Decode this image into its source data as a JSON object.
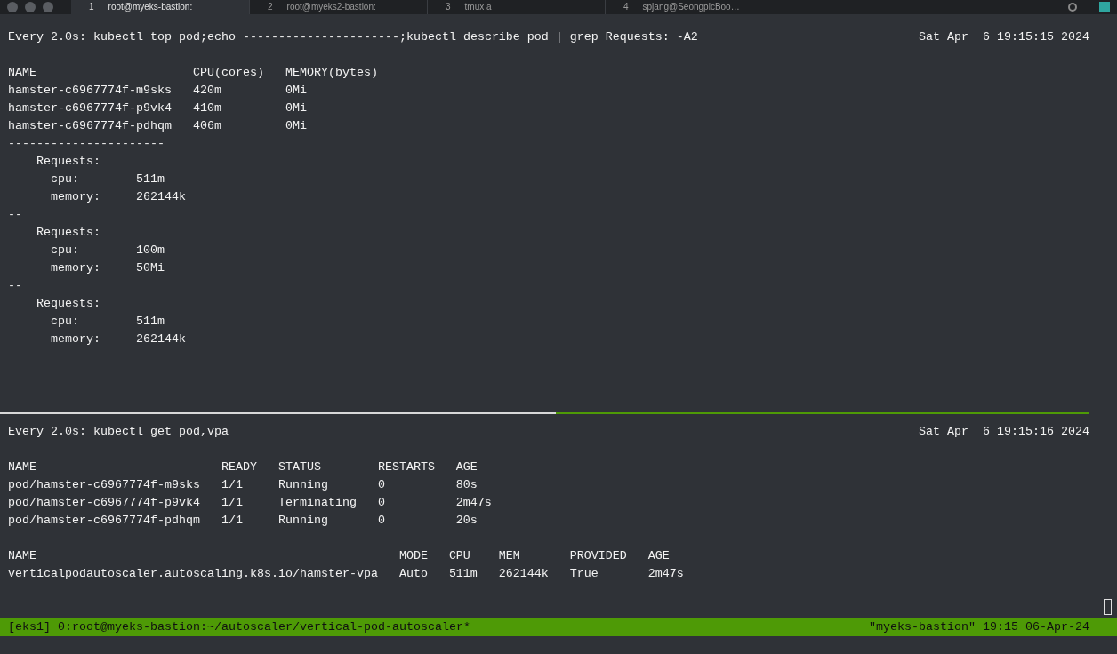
{
  "tabs": [
    {
      "number": "1",
      "title": "root@myeks-bastion:",
      "selected": true
    },
    {
      "number": "2",
      "title": "root@myeks2-bastion:",
      "selected": false
    },
    {
      "number": "3",
      "title": "tmux a",
      "selected": false
    },
    {
      "number": "4",
      "title": "spjang@SeongpicBoo…",
      "selected": false
    }
  ],
  "top_pane": {
    "command": "Every 2.0s: kubectl top pod;echo ----------------------;kubectl describe pod | grep Requests: -A2",
    "time": "Sat Apr  6 19:15:15 2024",
    "table": {
      "columns": [
        "NAME",
        "CPU(cores)",
        "MEMORY(bytes)"
      ],
      "rows": [
        [
          "hamster-c6967774f-m9sks",
          "420m",
          "0Mi"
        ],
        [
          "hamster-c6967774f-p9vk4",
          "410m",
          "0Mi"
        ],
        [
          "hamster-c6967774f-pdhqm",
          "406m",
          "0Mi"
        ]
      ]
    },
    "separator": "----------------------",
    "requests": [
      {
        "heading": "Requests:",
        "items": [
          {
            "key": "cpu:",
            "value": "511m"
          },
          {
            "key": "memory:",
            "value": "262144k"
          }
        ]
      },
      {
        "divider": "--",
        "heading": "Requests:",
        "items": [
          {
            "key": "cpu:",
            "value": "100m"
          },
          {
            "key": "memory:",
            "value": "50Mi"
          }
        ]
      },
      {
        "divider": "--",
        "heading": "Requests:",
        "items": [
          {
            "key": "cpu:",
            "value": "511m"
          },
          {
            "key": "memory:",
            "value": "262144k"
          }
        ]
      }
    ]
  },
  "bottom_pane": {
    "command": "Every 2.0s: kubectl get pod,vpa",
    "time": "Sat Apr  6 19:15:16 2024",
    "pods": {
      "columns": [
        "NAME",
        "READY",
        "STATUS",
        "RESTARTS",
        "AGE"
      ],
      "rows": [
        [
          "pod/hamster-c6967774f-m9sks",
          "1/1",
          "Running",
          "0",
          "80s"
        ],
        [
          "pod/hamster-c6967774f-p9vk4",
          "1/1",
          "Terminating",
          "0",
          "2m47s"
        ],
        [
          "pod/hamster-c6967774f-pdhqm",
          "1/1",
          "Running",
          "0",
          "20s"
        ]
      ]
    },
    "vpa": {
      "columns": [
        "NAME",
        "MODE",
        "CPU",
        "MEM",
        "PROVIDED",
        "AGE"
      ],
      "rows": [
        [
          "verticalpodautoscaler.autoscaling.k8s.io/hamster-vpa",
          "Auto",
          "511m",
          "262144k",
          "True",
          "2m47s"
        ]
      ]
    }
  },
  "status_bar": {
    "left": "[eks1] 0:root@myeks-bastion:~/autoscaler/vertical-pod-autoscaler*",
    "right": "\"myeks-bastion\" 19:15 06-Apr-24"
  }
}
